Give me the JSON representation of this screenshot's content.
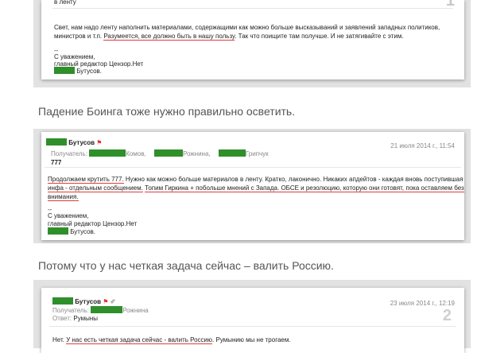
{
  "email1": {
    "page_number": "1",
    "top_text": "в ленту",
    "body_line1": "Свет, нам надо ленту наполнить материалами, содержащими как можно больше высказываний и заявлений западных политиков,",
    "body_line2_a": "министров и т.п. ",
    "body_line2_underlined": "Разумеется, все должно быть в нашу пользу",
    "body_line2_b": ". Так что поищите там получше. И не затягивайте с этим.",
    "sig_dash": "--",
    "sig_regards": "С уважением,",
    "sig_title": "главный редактор Цензор.Нет",
    "sig_name": "Бутусов."
  },
  "caption1": "Падение Боинга тоже нужно правильно осветить.",
  "email2": {
    "sender": "Бутусов",
    "date": "21 июля 2014 г., 11:54",
    "recipients_label": "Получатель:",
    "recipient1": "Комов,",
    "recipient2": "Рожнина,",
    "recipient3": "Грипчук",
    "subject": "777",
    "body_line1_underlined": "Продолжаем крутить 777.",
    "body_line1_rest": " Нужно как можно больше материалов в ленту. Кратко, лаконично. Никаких апдейтов - каждая вновь поступившая",
    "body_line2_underlined_a": "инфа - отдельным сообщением.",
    "body_line2_gap": " ",
    "body_line2_underlined_b": "Топим Гиркина + побольше мнений с Запада. ОБСЕ и резолюцию, которую они готовят, пока оставляем без",
    "body_line3_underlined": "внимания.",
    "sig_dash": "--",
    "sig_regards": "С уважением,",
    "sig_title": "главный редактор Цензор.Нет",
    "sig_name": "Бутусов."
  },
  "caption2": "Потому что у нас четкая задача сейчас – валить Россию.",
  "email3": {
    "sender": "Бутусов",
    "date": "23 июля 2014 г., 12:19",
    "recipients_label": "Получатель:",
    "recipient1": "Рожнина",
    "subject_label": "Ответ:",
    "subject": "Румыны",
    "page_number": "2",
    "body_a": "Нет. ",
    "body_underlined": "У нас есть четкая задача сейчас - валить Россию",
    "body_b": ". Румынию мы не трогаем."
  },
  "colors": {
    "redaction": "#2f8f2a",
    "underline": "#e23b3b",
    "panel": "#e2e2e2"
  }
}
